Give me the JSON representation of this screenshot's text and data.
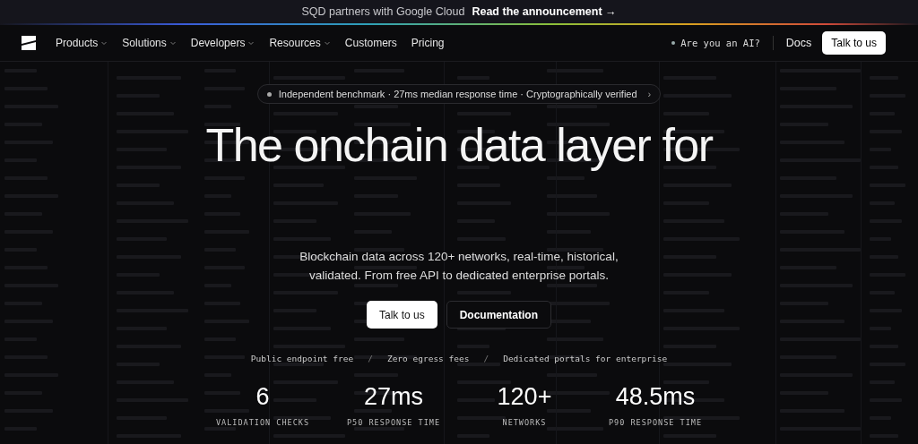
{
  "announcement": {
    "text": "SQD partners with Google Cloud",
    "link": "Read the announcement →"
  },
  "nav": {
    "items": [
      {
        "label": "Products",
        "has_menu": true
      },
      {
        "label": "Solutions",
        "has_menu": true
      },
      {
        "label": "Developers",
        "has_menu": true
      },
      {
        "label": "Resources",
        "has_menu": true
      },
      {
        "label": "Customers",
        "has_menu": false
      },
      {
        "label": "Pricing",
        "has_menu": false
      }
    ],
    "ai_link": "Are you an AI?",
    "docs": "Docs",
    "cta": "Talk to us"
  },
  "hero": {
    "badge": "Independent benchmark · 27ms median response time · Cryptographically verified",
    "badge_arrow": "›",
    "title": "The onchain data layer for",
    "subtitle": "Blockchain data across 120+ networks, real-time, historical, validated. From free API to dedicated enterprise portals.",
    "buttons": [
      {
        "label": "Talk to us",
        "kind": "primary"
      },
      {
        "label": "Documentation",
        "kind": "secondary"
      }
    ],
    "features": [
      "Public endpoint free",
      "Zero egress fees",
      "Dedicated portals for enterprise"
    ],
    "separator": "/",
    "stats": [
      {
        "value": "6",
        "label": "VALIDATION CHECKS"
      },
      {
        "value": "27ms",
        "label": "P50 RESPONSE TIME"
      },
      {
        "value": "120+",
        "label": "NETWORKS"
      },
      {
        "value": "48.5ms",
        "label": "P90 RESPONSE TIME"
      }
    ]
  }
}
